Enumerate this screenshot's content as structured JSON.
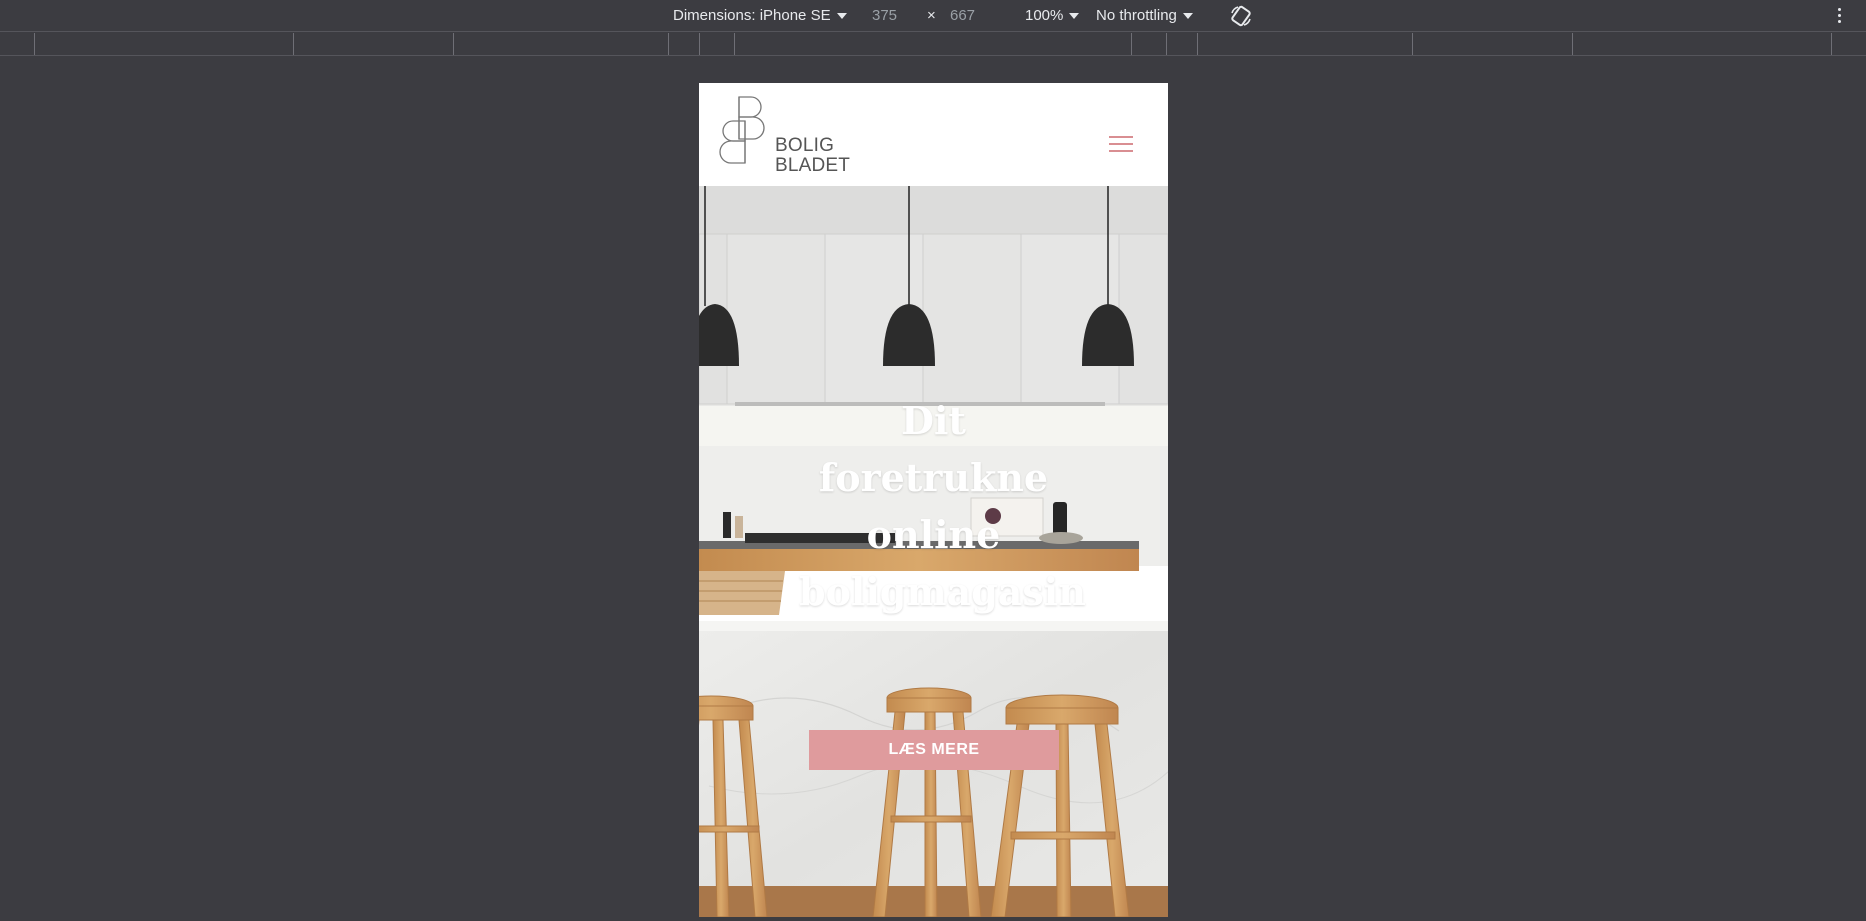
{
  "devtools": {
    "dimensions_label": "Dimensions: iPhone SE",
    "width_value": "375",
    "times_sign": "×",
    "height_value": "667",
    "zoom": "100%",
    "throttling": "No throttling"
  },
  "site": {
    "logo_line1": "BOLIG",
    "logo_line2": "BLADET",
    "hero_title": "Dit foretrukne online boligmagasin",
    "cta_label": "LÆS MERE"
  },
  "colors": {
    "accent": "#df9b9d",
    "burger": "#d98e92",
    "devtools_bg": "#3c3c41"
  }
}
